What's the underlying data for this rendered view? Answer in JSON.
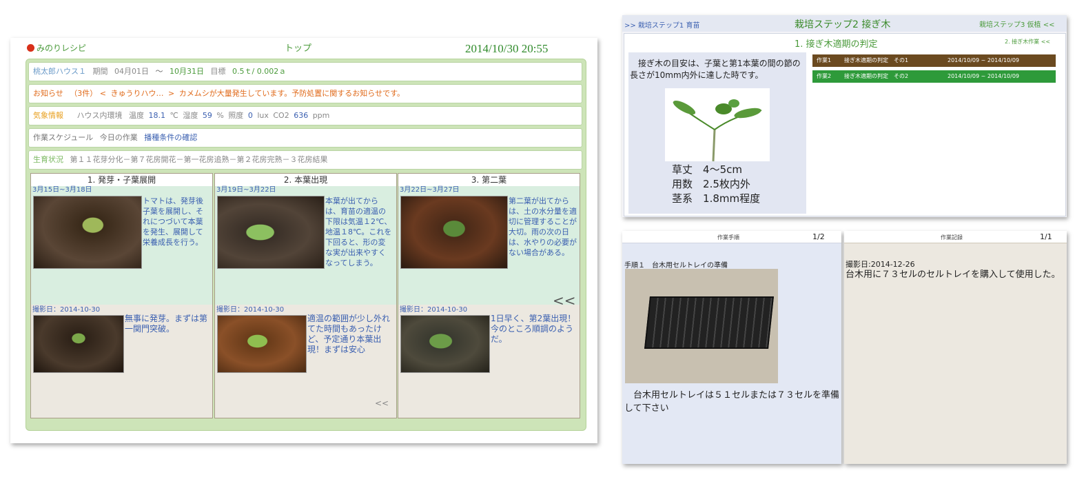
{
  "colors": {
    "accent_green": "#4a9a3a",
    "link_blue": "#3a5fb0",
    "warn_orange": "#e06a1a",
    "task1_bg": "#6b4a20",
    "task2_bg": "#2e9a3a"
  },
  "left": {
    "logo": "みのりレシピ",
    "nav_title": "トップ",
    "datetime": "2014/10/30 20:55",
    "house": {
      "name": "桃太郎ハウス１",
      "period_label": "期間",
      "start": "04月01日",
      "tilde": "～",
      "end": "10月31日",
      "goal_label": "目標",
      "goal1": "0.5ｔ/",
      "goal2": "0.002ａ"
    },
    "notice": {
      "label": "お知らせ",
      "count": "（3件）",
      "lt": "<",
      "source": "きゅうりハウ…",
      "gt": ">",
      "message": "カメムシが大量発生しています。予防処置に関するお知らせです。"
    },
    "weather": {
      "label": "気象情報",
      "env": "ハウス内環境",
      "temp_label": "温度",
      "temp": "18.1",
      "temp_unit": "℃",
      "hum_label": "湿度",
      "hum": "59",
      "hum_unit": "%",
      "lux_label": "照度",
      "lux": "0",
      "lux_unit": "lux",
      "co2_label": "CO2",
      "co2": "636",
      "co2_unit": "ppm"
    },
    "schedule": {
      "label": "作業スケジュール",
      "today": "今日の作業",
      "task": "播種条件の確認"
    },
    "growth": {
      "label": "生育状況",
      "text": "第１１花芽分化－第７花房開花－第一花房追熟－第２花房完熟－３花房結果"
    },
    "stages": [
      {
        "title": "1. 発芽・子葉展開",
        "range": "3月15日~3月18日",
        "desc": "トマトは、発芽後子葉を展開し、それにつづいて本葉を発生、展開して栄養成長を行う。",
        "photo_date": "撮影日：2014-10-30",
        "note": "無事に発芽。まずは第一関門突破。"
      },
      {
        "title": "2. 本葉出現",
        "range": "3月19日~3月22日",
        "desc": "本葉が出てからは、育苗の適温の下限は気温１2℃、地温１8℃。これを下回ると、形の変な実が出来やすくなってしまう。",
        "photo_date": "撮影日：2014-10-30",
        "note": "適温の範囲が少し外れてた時間もあったけど、予定通り本葉出現！まずは安心"
      },
      {
        "title": "3. 第二葉",
        "range": "3月22日~3月27日",
        "desc": "第二葉が出てからは、土の水分量を適切に管理することが大切。雨の次の日は、水やりの必要がない場合がある。",
        "photo_date": "撮影日：2014-10-30",
        "note": "1日早く、第2葉出現！今のところ順調のようだ。"
      }
    ],
    "prev_big": "<<",
    "prev_small": "<<"
  },
  "right_top": {
    "prev_step": ">> 栽培ステップ1 育苗",
    "current_step": "栽培ステップ2 接ぎ木",
    "next_step": "栽培ステップ3 仮植 <<",
    "section_title": "1. 接ぎ木適期の判定",
    "section_next": "2. 接ぎ木作業 <<",
    "intro": "接ぎ木の目安は、子葉と第1本葉の間の節の長さが10mm内外に達した時です。",
    "specs": [
      {
        "label": "草丈",
        "value": "4～5cm"
      },
      {
        "label": "用数",
        "value": "2.5枚内外"
      },
      {
        "label": "茎系",
        "value": "1.8mm程度"
      }
    ],
    "tasks": [
      {
        "id": "作業1",
        "name": "接ぎ木適期の判定　その1",
        "range": "2014/10/09 ~ 2014/10/09"
      },
      {
        "id": "作業2",
        "name": "接ぎ木適期の判定　その2",
        "range": "2014/10/09 ~ 2014/10/09"
      }
    ]
  },
  "procedure": {
    "header": "作業手順",
    "page": "1/2",
    "step": "手順１　台木用セルトレイの準備",
    "text": "台木用セルトレイは５１セルまたは７３セルを準備して下さい"
  },
  "record": {
    "header": "作業記録",
    "page": "1/1",
    "date": "撮影日:2014-12-26",
    "text": "台木用に７３セルのセルトレイを購入して使用した。"
  }
}
